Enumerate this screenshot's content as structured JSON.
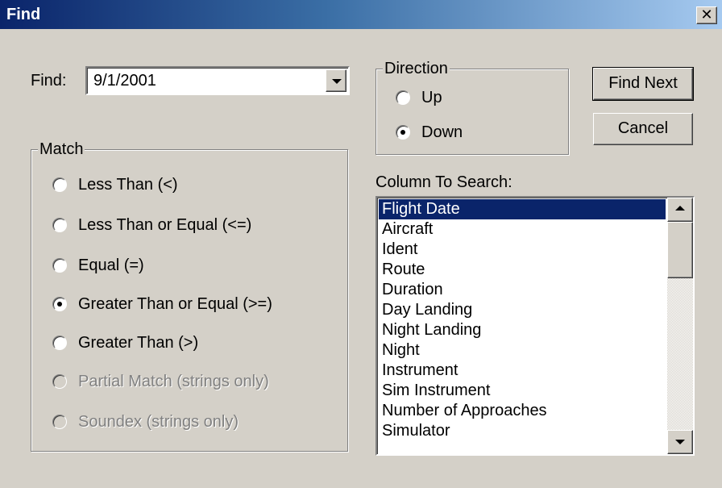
{
  "window": {
    "title": "Find",
    "close_glyph": "✕"
  },
  "find": {
    "label": "Find:",
    "value": "9/1/2001"
  },
  "match": {
    "legend": "Match",
    "options": [
      {
        "label": "Less Than (<)",
        "checked": false,
        "enabled": true
      },
      {
        "label": "Less Than or Equal (<=)",
        "checked": false,
        "enabled": true
      },
      {
        "label": "Equal (=)",
        "checked": false,
        "enabled": true
      },
      {
        "label": "Greater Than or Equal (>=)",
        "checked": true,
        "enabled": true
      },
      {
        "label": "Greater Than (>)",
        "checked": false,
        "enabled": true
      },
      {
        "label": "Partial Match (strings only)",
        "checked": false,
        "enabled": false
      },
      {
        "label": "Soundex (strings only)",
        "checked": false,
        "enabled": false
      }
    ]
  },
  "direction": {
    "legend": "Direction",
    "options": [
      {
        "label": "Up",
        "checked": false
      },
      {
        "label": "Down",
        "checked": true
      }
    ]
  },
  "buttons": {
    "find_next": "Find Next",
    "cancel": "Cancel"
  },
  "column": {
    "label": "Column To Search:",
    "items": [
      "Flight Date",
      "Aircraft",
      "Ident",
      "Route",
      "Duration",
      "Day Landing",
      "Night Landing",
      "Night",
      "Instrument",
      "Sim Instrument",
      "Number of Approaches",
      "Simulator"
    ],
    "selected_index": 0
  },
  "colors": {
    "titlebar_start": "#0a246a",
    "titlebar_end": "#a6caf0",
    "face": "#d4d0c8",
    "selection": "#0a246a"
  }
}
